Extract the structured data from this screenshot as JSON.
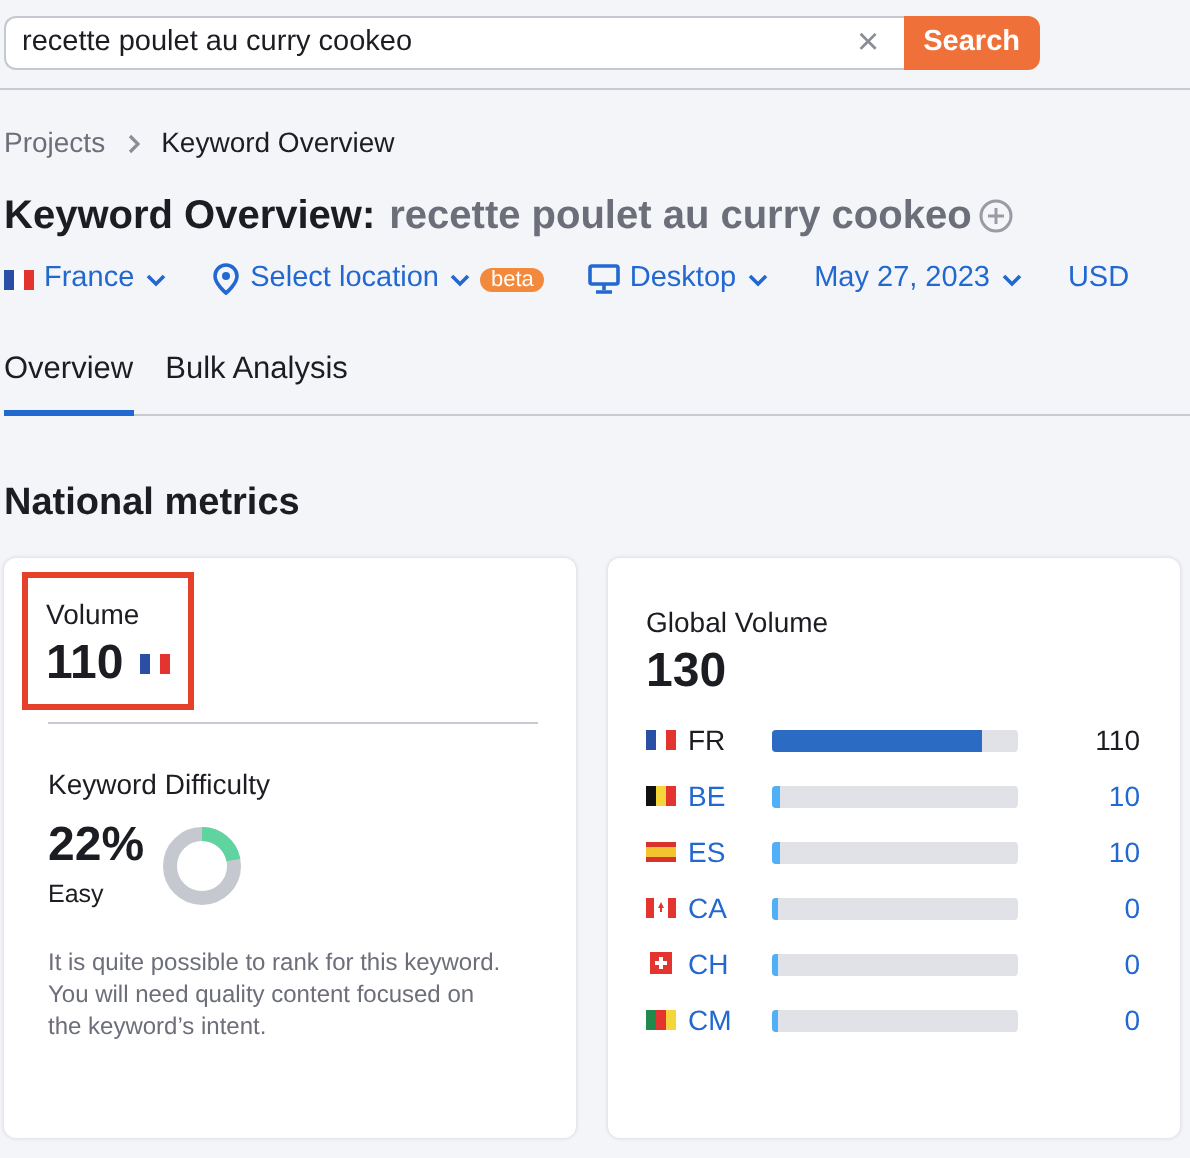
{
  "search": {
    "value": "recette poulet au curry cookeo",
    "clear": "×",
    "button": "Search"
  },
  "breadcrumb": [
    "Projects",
    "Keyword Overview"
  ],
  "title": {
    "label": "Keyword Overview:",
    "keyword": "recette poulet au curry cookeo"
  },
  "filters": [
    {
      "kind": "flag",
      "label": "France",
      "caret": true
    },
    {
      "kind": "location",
      "label": "Select location",
      "caret": true,
      "badge": "beta"
    },
    {
      "kind": "device",
      "label": "Desktop",
      "caret": true
    },
    {
      "kind": "plain",
      "label": "May 27, 2023",
      "caret": true
    },
    {
      "kind": "plain",
      "label": "USD",
      "caret": false
    }
  ],
  "tabs": [
    {
      "label": "Overview",
      "selected": true
    },
    {
      "label": "Bulk Analysis",
      "selected": false
    }
  ],
  "section_title": "National metrics",
  "volume": {
    "label": "Volume",
    "value": "110",
    "highlighted": true
  },
  "difficulty": {
    "label": "Keyword Difficulty",
    "value": "22%",
    "rating": "Easy",
    "level": 0.22,
    "description": "It is quite possible to rank for this keyword. You will need quality content focused on the keyword’s intent."
  },
  "global_volume": {
    "label": "Global Volume",
    "value": "130",
    "countries": [
      {
        "kind": "fr",
        "code": "FR",
        "value": "110",
        "level": 0.85,
        "selected": true
      },
      {
        "kind": "be",
        "code": "BE",
        "value": "10",
        "level": 0.03,
        "selected": false
      },
      {
        "kind": "es",
        "code": "ES",
        "value": "10",
        "level": 0.03,
        "selected": false
      },
      {
        "kind": "ca",
        "code": "CA",
        "value": "0",
        "level": 0.01,
        "selected": false
      },
      {
        "kind": "ch",
        "code": "CH",
        "value": "0",
        "level": 0.01,
        "selected": false
      },
      {
        "kind": "cm",
        "code": "CM",
        "value": "0",
        "level": 0.01,
        "selected": false
      }
    ]
  }
}
